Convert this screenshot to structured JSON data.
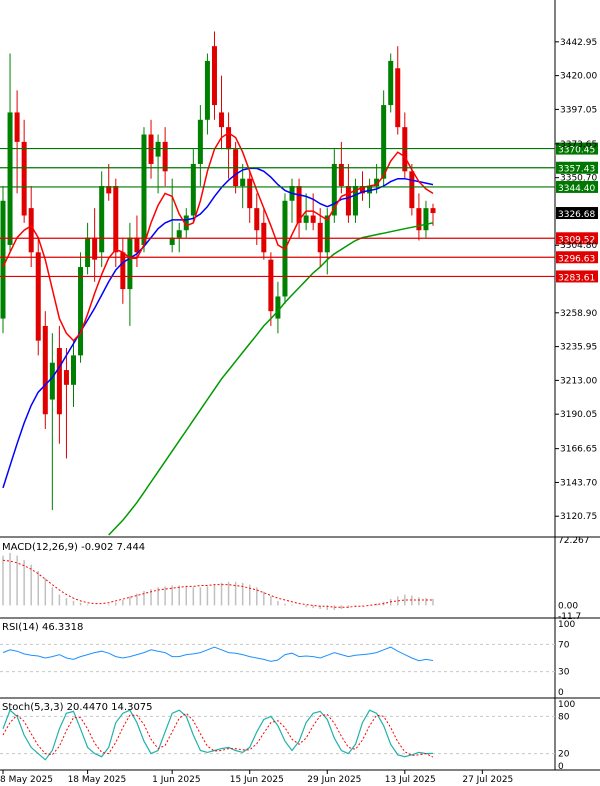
{
  "colors": {
    "background": "#ffffff",
    "bull": "#008000",
    "bear": "#e00000",
    "ma_fast": "#ff0000",
    "ma_mid": "#0000ff",
    "ma_slow": "#009900",
    "support_line": "#e00000",
    "resistance_line": "#007700",
    "current_price_box": "#000000",
    "macd_hist": "#c0c0c0",
    "rsi_line": "#1e90ff",
    "stoch_main": "#20b2aa",
    "stoch_signal": "#ff0000",
    "axis": "#000000"
  },
  "chart_data": [
    {
      "type": "candlestick",
      "panel": "price",
      "ylim": [
        3108,
        3470
      ],
      "y_ticks": [
        "3442.95",
        "3420.00",
        "3397.05",
        "3373.65",
        "3350.70",
        "3304.80",
        "3258.90",
        "3235.95",
        "3213.00",
        "3190.05",
        "3166.65",
        "3143.70",
        "3120.75"
      ],
      "current_price": "3326.68",
      "horizontal_levels": [
        {
          "value": 3370.45,
          "label": "3370.45",
          "kind": "resistance"
        },
        {
          "value": 3357.43,
          "label": "3357.43",
          "kind": "resistance"
        },
        {
          "value": 3344.4,
          "label": "3344.40",
          "kind": "resistance"
        },
        {
          "value": 3309.52,
          "label": "3309.52",
          "kind": "support"
        },
        {
          "value": 3296.63,
          "label": "3296.63",
          "kind": "support"
        },
        {
          "value": 3283.61,
          "label": "3283.61",
          "kind": "support"
        }
      ],
      "candles": [
        {
          "o": 3255,
          "h": 3345,
          "l": 3245,
          "c": 3335
        },
        {
          "o": 3305,
          "h": 3435,
          "l": 3300,
          "c": 3395
        },
        {
          "o": 3395,
          "h": 3410,
          "l": 3340,
          "c": 3375
        },
        {
          "o": 3375,
          "h": 3390,
          "l": 3320,
          "c": 3325
        },
        {
          "o": 3330,
          "h": 3345,
          "l": 3290,
          "c": 3300
        },
        {
          "o": 3300,
          "h": 3310,
          "l": 3230,
          "c": 3240
        },
        {
          "o": 3250,
          "h": 3260,
          "l": 3180,
          "c": 3190
        },
        {
          "o": 3200,
          "h": 3245,
          "l": 3125,
          "c": 3225
        },
        {
          "o": 3235,
          "h": 3250,
          "l": 3170,
          "c": 3190
        },
        {
          "o": 3220,
          "h": 3235,
          "l": 3160,
          "c": 3210
        },
        {
          "o": 3210,
          "h": 3240,
          "l": 3195,
          "c": 3230
        },
        {
          "o": 3230,
          "h": 3300,
          "l": 3225,
          "c": 3290
        },
        {
          "o": 3290,
          "h": 3320,
          "l": 3285,
          "c": 3310
        },
        {
          "o": 3310,
          "h": 3330,
          "l": 3280,
          "c": 3295
        },
        {
          "o": 3300,
          "h": 3355,
          "l": 3290,
          "c": 3345
        },
        {
          "o": 3345,
          "h": 3360,
          "l": 3335,
          "c": 3340
        },
        {
          "o": 3345,
          "h": 3350,
          "l": 3290,
          "c": 3300
        },
        {
          "o": 3300,
          "h": 3310,
          "l": 3265,
          "c": 3275
        },
        {
          "o": 3275,
          "h": 3320,
          "l": 3250,
          "c": 3310
        },
        {
          "o": 3310,
          "h": 3325,
          "l": 3290,
          "c": 3300
        },
        {
          "o": 3305,
          "h": 3385,
          "l": 3300,
          "c": 3380
        },
        {
          "o": 3380,
          "h": 3390,
          "l": 3350,
          "c": 3360
        },
        {
          "o": 3365,
          "h": 3380,
          "l": 3340,
          "c": 3375
        },
        {
          "o": 3375,
          "h": 3385,
          "l": 3345,
          "c": 3355
        },
        {
          "o": 3305,
          "h": 3350,
          "l": 3300,
          "c": 3310
        },
        {
          "o": 3310,
          "h": 3320,
          "l": 3300,
          "c": 3315
        },
        {
          "o": 3315,
          "h": 3330,
          "l": 3310,
          "c": 3325
        },
        {
          "o": 3325,
          "h": 3370,
          "l": 3320,
          "c": 3360
        },
        {
          "o": 3360,
          "h": 3400,
          "l": 3345,
          "c": 3390
        },
        {
          "o": 3390,
          "h": 3435,
          "l": 3380,
          "c": 3430
        },
        {
          "o": 3440,
          "h": 3450,
          "l": 3390,
          "c": 3400
        },
        {
          "o": 3395,
          "h": 3420,
          "l": 3370,
          "c": 3385
        },
        {
          "o": 3385,
          "h": 3395,
          "l": 3350,
          "c": 3370
        },
        {
          "o": 3370,
          "h": 3375,
          "l": 3340,
          "c": 3345
        },
        {
          "o": 3345,
          "h": 3360,
          "l": 3330,
          "c": 3350
        },
        {
          "o": 3350,
          "h": 3355,
          "l": 3320,
          "c": 3330
        },
        {
          "o": 3330,
          "h": 3340,
          "l": 3305,
          "c": 3315
        },
        {
          "o": 3320,
          "h": 3330,
          "l": 3295,
          "c": 3300
        },
        {
          "o": 3295,
          "h": 3300,
          "l": 3250,
          "c": 3260
        },
        {
          "o": 3255,
          "h": 3280,
          "l": 3245,
          "c": 3270
        },
        {
          "o": 3270,
          "h": 3340,
          "l": 3265,
          "c": 3335
        },
        {
          "o": 3335,
          "h": 3350,
          "l": 3320,
          "c": 3345
        },
        {
          "o": 3345,
          "h": 3350,
          "l": 3310,
          "c": 3320
        },
        {
          "o": 3320,
          "h": 3340,
          "l": 3315,
          "c": 3325
        },
        {
          "o": 3325,
          "h": 3340,
          "l": 3315,
          "c": 3320
        },
        {
          "o": 3320,
          "h": 3330,
          "l": 3290,
          "c": 3300
        },
        {
          "o": 3300,
          "h": 3330,
          "l": 3285,
          "c": 3325
        },
        {
          "o": 3325,
          "h": 3370,
          "l": 3320,
          "c": 3360
        },
        {
          "o": 3360,
          "h": 3375,
          "l": 3340,
          "c": 3345
        },
        {
          "o": 3345,
          "h": 3360,
          "l": 3320,
          "c": 3325
        },
        {
          "o": 3325,
          "h": 3350,
          "l": 3320,
          "c": 3345
        },
        {
          "o": 3345,
          "h": 3355,
          "l": 3335,
          "c": 3340
        },
        {
          "o": 3340,
          "h": 3350,
          "l": 3330,
          "c": 3345
        },
        {
          "o": 3345,
          "h": 3360,
          "l": 3340,
          "c": 3350
        },
        {
          "o": 3350,
          "h": 3410,
          "l": 3345,
          "c": 3400
        },
        {
          "o": 3400,
          "h": 3435,
          "l": 3395,
          "c": 3430
        },
        {
          "o": 3425,
          "h": 3440,
          "l": 3380,
          "c": 3385
        },
        {
          "o": 3385,
          "h": 3395,
          "l": 3350,
          "c": 3355
        },
        {
          "o": 3355,
          "h": 3360,
          "l": 3325,
          "c": 3330
        },
        {
          "o": 3330,
          "h": 3340,
          "l": 3308,
          "c": 3315
        },
        {
          "o": 3315,
          "h": 3335,
          "l": 3310,
          "c": 3330
        },
        {
          "o": 3330,
          "h": 3333,
          "l": 3318,
          "c": 3326.68
        }
      ],
      "ma_fast": [
        3290,
        3300,
        3310,
        3315,
        3318,
        3310,
        3295,
        3275,
        3255,
        3245,
        3240,
        3245,
        3258,
        3272,
        3285,
        3296,
        3302,
        3300,
        3296,
        3296,
        3305,
        3320,
        3332,
        3340,
        3338,
        3326,
        3318,
        3320,
        3335,
        3355,
        3370,
        3378,
        3381,
        3378,
        3368,
        3355,
        3342,
        3330,
        3318,
        3305,
        3302,
        3312,
        3322,
        3328,
        3328,
        3325,
        3322,
        3330,
        3338,
        3340,
        3342,
        3344,
        3345,
        3346,
        3352,
        3362,
        3368,
        3365,
        3356,
        3348,
        3343,
        3340
      ],
      "ma_mid": [
        3140,
        3155,
        3170,
        3184,
        3196,
        3205,
        3210,
        3215,
        3222,
        3230,
        3238,
        3246,
        3254,
        3262,
        3271,
        3280,
        3288,
        3293,
        3296,
        3299,
        3304,
        3310,
        3316,
        3320,
        3322,
        3322,
        3322,
        3323,
        3326,
        3331,
        3338,
        3344,
        3349,
        3353,
        3356,
        3357,
        3357,
        3355,
        3351,
        3346,
        3342,
        3340,
        3339,
        3338,
        3336,
        3333,
        3331,
        3333,
        3336,
        3337,
        3339,
        3341,
        3342,
        3343,
        3345,
        3348,
        3350,
        3350,
        3349,
        3348,
        3347,
        3346
      ],
      "ma_slow_start_index": 15,
      "ma_slow": [
        3108,
        3113,
        3118,
        3124,
        3130,
        3137,
        3144,
        3151,
        3158,
        3165,
        3172,
        3179,
        3186,
        3193,
        3200,
        3207,
        3214,
        3220,
        3226,
        3232,
        3238,
        3244,
        3250,
        3255,
        3260,
        3266,
        3271,
        3276,
        3281,
        3286,
        3290,
        3295,
        3299,
        3302,
        3305,
        3308,
        3310,
        3311,
        3312,
        3313,
        3314,
        3315,
        3316,
        3317,
        3318,
        3319,
        3320
      ]
    },
    {
      "type": "bar",
      "panel": "macd",
      "title": "MACD(12,26,9) -0.902 7.444",
      "y_ticks": [
        "72.267",
        "0.00",
        "-11.7"
      ],
      "ylim": [
        -11.7,
        72.267
      ],
      "histogram": [
        55,
        58,
        55,
        50,
        45,
        38,
        30,
        20,
        12,
        8,
        5,
        3,
        1,
        0,
        0,
        1,
        3,
        6,
        10,
        13,
        16,
        18,
        20,
        21,
        22,
        22,
        21,
        20,
        20,
        21,
        23,
        25,
        26,
        26,
        25,
        23,
        20,
        15,
        10,
        5,
        2,
        1,
        0,
        -2,
        -3,
        -4,
        -5,
        -5,
        -4,
        -3,
        -2,
        -1,
        0,
        2,
        4,
        7,
        10,
        12,
        11,
        9,
        8,
        7.4
      ],
      "signal": [
        50,
        49,
        47,
        44,
        40,
        35,
        29,
        23,
        17,
        12,
        8,
        5,
        3,
        2,
        2,
        3,
        5,
        7,
        9,
        11,
        13,
        15,
        17,
        18,
        19,
        20,
        21,
        21,
        22,
        22,
        23,
        23,
        23,
        22,
        21,
        19,
        17,
        14,
        11,
        8,
        6,
        4,
        2,
        1,
        0,
        -1,
        -1,
        -2,
        -2,
        -2,
        -1,
        -1,
        0,
        1,
        2,
        4,
        5,
        6,
        6,
        6,
        6,
        6
      ]
    },
    {
      "type": "line",
      "panel": "rsi",
      "title": "RSI(14) 46.3318",
      "y_ticks": [
        "100",
        "70",
        "30",
        "0"
      ],
      "ylim": [
        0,
        100
      ],
      "values": [
        58,
        62,
        60,
        56,
        54,
        53,
        50,
        52,
        55,
        50,
        48,
        52,
        55,
        58,
        60,
        57,
        52,
        50,
        52,
        55,
        58,
        62,
        60,
        58,
        52,
        52,
        55,
        56,
        58,
        62,
        66,
        62,
        58,
        57,
        55,
        52,
        50,
        48,
        45,
        47,
        55,
        57,
        52,
        53,
        52,
        50,
        54,
        58,
        55,
        52,
        54,
        55,
        56,
        58,
        62,
        66,
        60,
        55,
        50,
        46,
        48,
        46.3
      ]
    },
    {
      "type": "line",
      "panel": "stoch",
      "title": "Stoch(5,3,3) 20.4470 14.3075",
      "y_ticks": [
        "100",
        "80",
        "20",
        "0"
      ],
      "ylim": [
        0,
        100
      ],
      "main": [
        60,
        90,
        80,
        50,
        30,
        20,
        10,
        25,
        60,
        85,
        88,
        60,
        30,
        20,
        15,
        30,
        70,
        85,
        90,
        70,
        40,
        20,
        25,
        55,
        85,
        90,
        80,
        50,
        25,
        22,
        25,
        28,
        30,
        25,
        22,
        30,
        55,
        75,
        80,
        65,
        40,
        25,
        40,
        70,
        85,
        88,
        75,
        45,
        25,
        20,
        35,
        70,
        90,
        85,
        65,
        35,
        18,
        15,
        18,
        22,
        20,
        20.4
      ],
      "signal": [
        50,
        70,
        82,
        72,
        52,
        33,
        20,
        18,
        32,
        57,
        78,
        78,
        60,
        37,
        22,
        20,
        38,
        62,
        82,
        82,
        67,
        43,
        28,
        33,
        55,
        77,
        85,
        73,
        52,
        32,
        24,
        25,
        28,
        28,
        26,
        26,
        36,
        53,
        70,
        73,
        62,
        43,
        35,
        45,
        65,
        81,
        83,
        69,
        48,
        30,
        27,
        42,
        65,
        82,
        80,
        62,
        39,
        23,
        17,
        18,
        20,
        14.3
      ]
    }
  ],
  "x_labels": [
    "8 May 2025",
    "18 May 2025",
    "1 Jun 2025",
    "15 Jun 2025",
    "29 Jun 2025",
    "13 Jul 2025",
    "27 Jul 2025"
  ],
  "x_label_index": [
    0,
    12,
    24,
    35,
    46,
    57,
    68
  ]
}
